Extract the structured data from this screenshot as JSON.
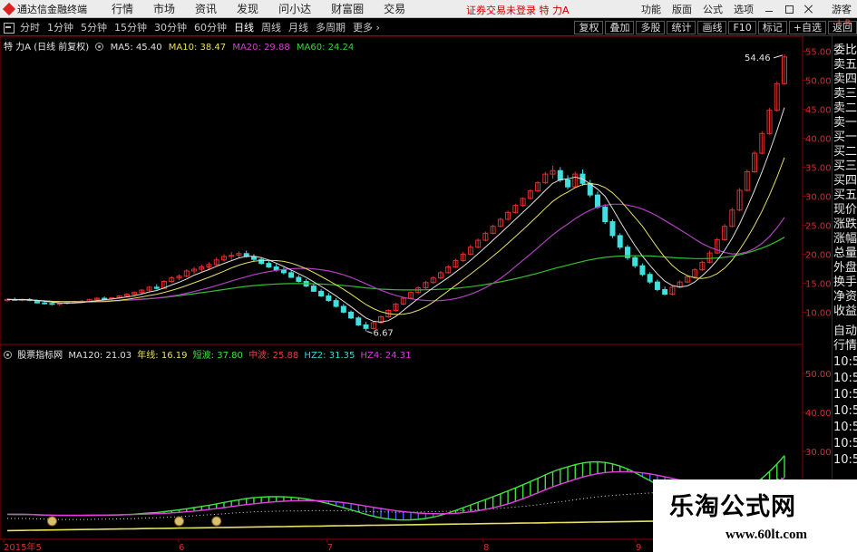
{
  "menubar": {
    "app_title": "通达信金融终端",
    "items": [
      "行情",
      "市场",
      "资讯",
      "发现",
      "问小达",
      "财富圈",
      "交易"
    ],
    "status_warning": "证券交易未登录  特 力A",
    "right_items": [
      "功能",
      "版面",
      "公式",
      "选项"
    ],
    "guest": "游客"
  },
  "periodbar": {
    "periods": [
      "分时",
      "1分钟",
      "5分钟",
      "15分钟",
      "30分钟",
      "60分钟",
      "日线",
      "周线",
      "月线",
      "多周期"
    ],
    "active_period": "日线",
    "more": "更多 ›",
    "tools": [
      "复权",
      "叠加",
      "多股",
      "统计",
      "画线",
      "F10",
      "标记",
      "+自选",
      "返回"
    ]
  },
  "main_panel": {
    "title": "特 力A (日线 前复权)",
    "indicators": [
      {
        "label": "MA5: 45.40",
        "color": "#e0e0e0"
      },
      {
        "label": "MA10: 38.47",
        "color": "#e8e060"
      },
      {
        "label": "MA20: 29.88",
        "color": "#d040d0"
      },
      {
        "label": "MA60: 24.24",
        "color": "#40d040"
      }
    ],
    "price_axis": [
      "55.00",
      "50.00",
      "45.00",
      "40.00",
      "35.00",
      "30.00",
      "25.00",
      "20.00",
      "15.00",
      "10.00"
    ],
    "high_label": "54.46",
    "low_label": "6.67"
  },
  "sub_panel": {
    "title": "股票指标网",
    "indicators": [
      {
        "label": "MA120: 21.03",
        "color": "#e0e0e0"
      },
      {
        "label": "年线: 16.19",
        "color": "#e8e060"
      },
      {
        "label": "短波: 37.80",
        "color": "#40e040"
      },
      {
        "label": "中波: 25.88",
        "color": "#e04040"
      },
      {
        "label": "HZ2: 31.35",
        "color": "#40d0d0"
      },
      {
        "label": "HZ4: 24.31",
        "color": "#d040d0"
      }
    ],
    "axis": [
      "50.00",
      "40.00",
      "30.00"
    ]
  },
  "time_axis": [
    "2015年5",
    "6",
    "7",
    "8",
    "9"
  ],
  "side_panel": {
    "top_label": "L R",
    "items": [
      "委比",
      "卖五",
      "卖四",
      "卖三",
      "卖二",
      "卖一",
      "买一",
      "买二",
      "买三",
      "买四",
      "买五",
      "现价",
      "涨跌",
      "涨幅",
      "总量",
      "外盘",
      "换手",
      "净资",
      "收益",
      "自动",
      "行情",
      "10:5",
      "10:5",
      "10:5",
      "10:5",
      "10:5",
      "10:5",
      "10:5"
    ]
  },
  "watermark": {
    "title": "乐淘公式网",
    "url": "www.60lt.com"
  },
  "colors": {
    "candle_up": "#e03030",
    "candle_down": "#40e0e0",
    "ma5": "#e0e0e0",
    "ma10": "#e8e060",
    "ma20": "#b040c0",
    "ma60": "#30c030",
    "axis_border": "#8b0000",
    "short_wave": "#40e040",
    "mid_wave": "#e040e0",
    "long_wave": "#4060ff",
    "year_line": "#e8e060"
  },
  "chart_data": {
    "type": "candlestick",
    "ylim": [
      6,
      56
    ],
    "candles": [
      [
        12.0,
        12.3,
        11.8,
        12.2
      ],
      [
        12.2,
        12.5,
        12.0,
        12.1
      ],
      [
        12.1,
        12.3,
        11.9,
        12.2
      ],
      [
        12.2,
        12.4,
        11.9,
        12.0
      ],
      [
        12.0,
        12.2,
        11.5,
        11.6
      ],
      [
        11.6,
        11.8,
        11.3,
        11.5
      ],
      [
        11.5,
        11.7,
        11.2,
        11.4
      ],
      [
        11.4,
        11.6,
        11.1,
        11.5
      ],
      [
        11.5,
        11.8,
        11.3,
        11.7
      ],
      [
        11.7,
        12.0,
        11.5,
        11.8
      ],
      [
        11.8,
        12.1,
        11.6,
        11.9
      ],
      [
        11.9,
        12.3,
        11.7,
        12.2
      ],
      [
        12.2,
        12.6,
        12.0,
        12.4
      ],
      [
        12.4,
        12.7,
        12.1,
        12.3
      ],
      [
        12.3,
        12.6,
        12.0,
        12.5
      ],
      [
        12.5,
        12.9,
        12.3,
        12.8
      ],
      [
        12.8,
        13.3,
        12.6,
        13.1
      ],
      [
        13.1,
        13.6,
        12.9,
        13.4
      ],
      [
        13.4,
        14.0,
        13.2,
        13.8
      ],
      [
        13.8,
        14.5,
        13.6,
        14.3
      ],
      [
        14.3,
        14.8,
        13.9,
        14.1
      ],
      [
        14.1,
        15.5,
        14.0,
        15.3
      ],
      [
        15.3,
        16.2,
        15.0,
        15.9
      ],
      [
        15.9,
        16.5,
        15.5,
        16.2
      ],
      [
        16.2,
        17.4,
        16.0,
        17.1
      ],
      [
        17.1,
        17.8,
        16.6,
        17.4
      ],
      [
        17.4,
        18.2,
        17.0,
        17.8
      ],
      [
        17.8,
        18.6,
        17.3,
        18.2
      ],
      [
        18.2,
        19.5,
        18.0,
        19.0
      ],
      [
        19.0,
        20.0,
        18.7,
        19.6
      ],
      [
        19.6,
        20.4,
        19.0,
        19.8
      ],
      [
        19.8,
        20.5,
        19.3,
        20.1
      ],
      [
        20.1,
        20.6,
        19.4,
        19.6
      ],
      [
        19.6,
        20.0,
        18.8,
        19.1
      ],
      [
        19.1,
        19.5,
        18.2,
        18.4
      ],
      [
        18.4,
        18.8,
        17.6,
        17.8
      ],
      [
        17.8,
        18.3,
        17.0,
        17.3
      ],
      [
        17.3,
        17.7,
        16.5,
        16.8
      ],
      [
        16.8,
        17.2,
        15.9,
        16.0
      ],
      [
        16.0,
        16.4,
        15.1,
        15.3
      ],
      [
        15.3,
        15.7,
        14.3,
        14.5
      ],
      [
        14.5,
        14.9,
        13.5,
        13.6
      ],
      [
        13.6,
        14.0,
        12.6,
        12.8
      ],
      [
        12.8,
        13.3,
        11.8,
        12.0
      ],
      [
        12.0,
        12.4,
        10.8,
        11.0
      ],
      [
        11.0,
        11.4,
        9.8,
        10.0
      ],
      [
        10.0,
        10.3,
        8.8,
        9.0
      ],
      [
        9.0,
        9.3,
        7.6,
        7.8
      ],
      [
        7.8,
        8.3,
        6.7,
        7.2
      ],
      [
        7.2,
        8.4,
        7.0,
        8.2
      ],
      [
        8.2,
        9.4,
        8.0,
        9.2
      ],
      [
        9.2,
        10.5,
        9.0,
        10.3
      ],
      [
        10.3,
        11.6,
        10.1,
        11.4
      ],
      [
        11.4,
        12.6,
        11.2,
        12.4
      ],
      [
        12.4,
        13.6,
        12.2,
        13.4
      ],
      [
        13.4,
        14.5,
        13.1,
        14.2
      ],
      [
        14.2,
        15.4,
        14.0,
        15.1
      ],
      [
        15.1,
        16.2,
        14.9,
        15.9
      ],
      [
        15.9,
        17.1,
        15.7,
        16.8
      ],
      [
        16.8,
        18.1,
        16.6,
        17.8
      ],
      [
        17.8,
        19.2,
        17.6,
        18.9
      ],
      [
        18.9,
        20.4,
        18.7,
        20.0
      ],
      [
        20.0,
        21.6,
        19.8,
        21.2
      ],
      [
        21.2,
        22.7,
        21.0,
        22.4
      ],
      [
        22.4,
        23.9,
        22.2,
        23.6
      ],
      [
        23.6,
        25.1,
        23.4,
        24.8
      ],
      [
        24.8,
        26.3,
        24.6,
        26.0
      ],
      [
        26.0,
        27.5,
        25.8,
        27.2
      ],
      [
        27.2,
        28.7,
        27.0,
        28.4
      ],
      [
        28.4,
        29.8,
        28.2,
        29.6
      ],
      [
        29.6,
        31.2,
        29.4,
        30.9
      ],
      [
        30.9,
        32.6,
        30.7,
        32.3
      ],
      [
        32.3,
        34.2,
        32.1,
        33.8
      ],
      [
        33.8,
        35.2,
        33.0,
        34.4
      ],
      [
        34.4,
        35.0,
        32.4,
        32.8
      ],
      [
        32.8,
        33.6,
        31.2,
        31.6
      ],
      [
        31.6,
        34.2,
        31.4,
        33.8
      ],
      [
        33.8,
        34.6,
        31.8,
        32.2
      ],
      [
        32.2,
        32.8,
        29.8,
        30.2
      ],
      [
        30.2,
        30.8,
        27.8,
        28.1
      ],
      [
        28.1,
        28.6,
        25.2,
        25.6
      ],
      [
        25.6,
        26.0,
        22.8,
        23.2
      ],
      [
        23.2,
        23.6,
        20.8,
        21.2
      ],
      [
        21.2,
        21.6,
        19.0,
        19.4
      ],
      [
        19.4,
        19.8,
        17.6,
        18.0
      ],
      [
        18.0,
        18.4,
        16.2,
        16.5
      ],
      [
        16.5,
        16.9,
        14.9,
        15.2
      ],
      [
        15.2,
        15.6,
        13.6,
        13.9
      ],
      [
        13.9,
        14.4,
        12.9,
        13.1
      ],
      [
        13.1,
        14.6,
        12.9,
        14.3
      ],
      [
        14.3,
        15.5,
        14.1,
        15.2
      ],
      [
        15.2,
        16.4,
        15.0,
        16.1
      ],
      [
        16.1,
        17.6,
        15.9,
        17.3
      ],
      [
        17.3,
        18.9,
        17.1,
        18.6
      ],
      [
        18.6,
        20.6,
        18.4,
        20.2
      ],
      [
        20.2,
        22.8,
        20.0,
        22.5
      ],
      [
        22.5,
        25.2,
        22.3,
        24.8
      ],
      [
        24.8,
        28.0,
        24.6,
        27.6
      ],
      [
        27.6,
        31.4,
        27.4,
        31.0
      ],
      [
        31.0,
        34.6,
        30.8,
        34.2
      ],
      [
        34.2,
        37.8,
        34.0,
        37.4
      ],
      [
        37.4,
        41.2,
        37.2,
        40.8
      ],
      [
        40.8,
        45.2,
        40.6,
        44.8
      ],
      [
        44.8,
        49.8,
        44.6,
        49.4
      ],
      [
        49.4,
        54.46,
        49.2,
        54.0
      ]
    ]
  }
}
